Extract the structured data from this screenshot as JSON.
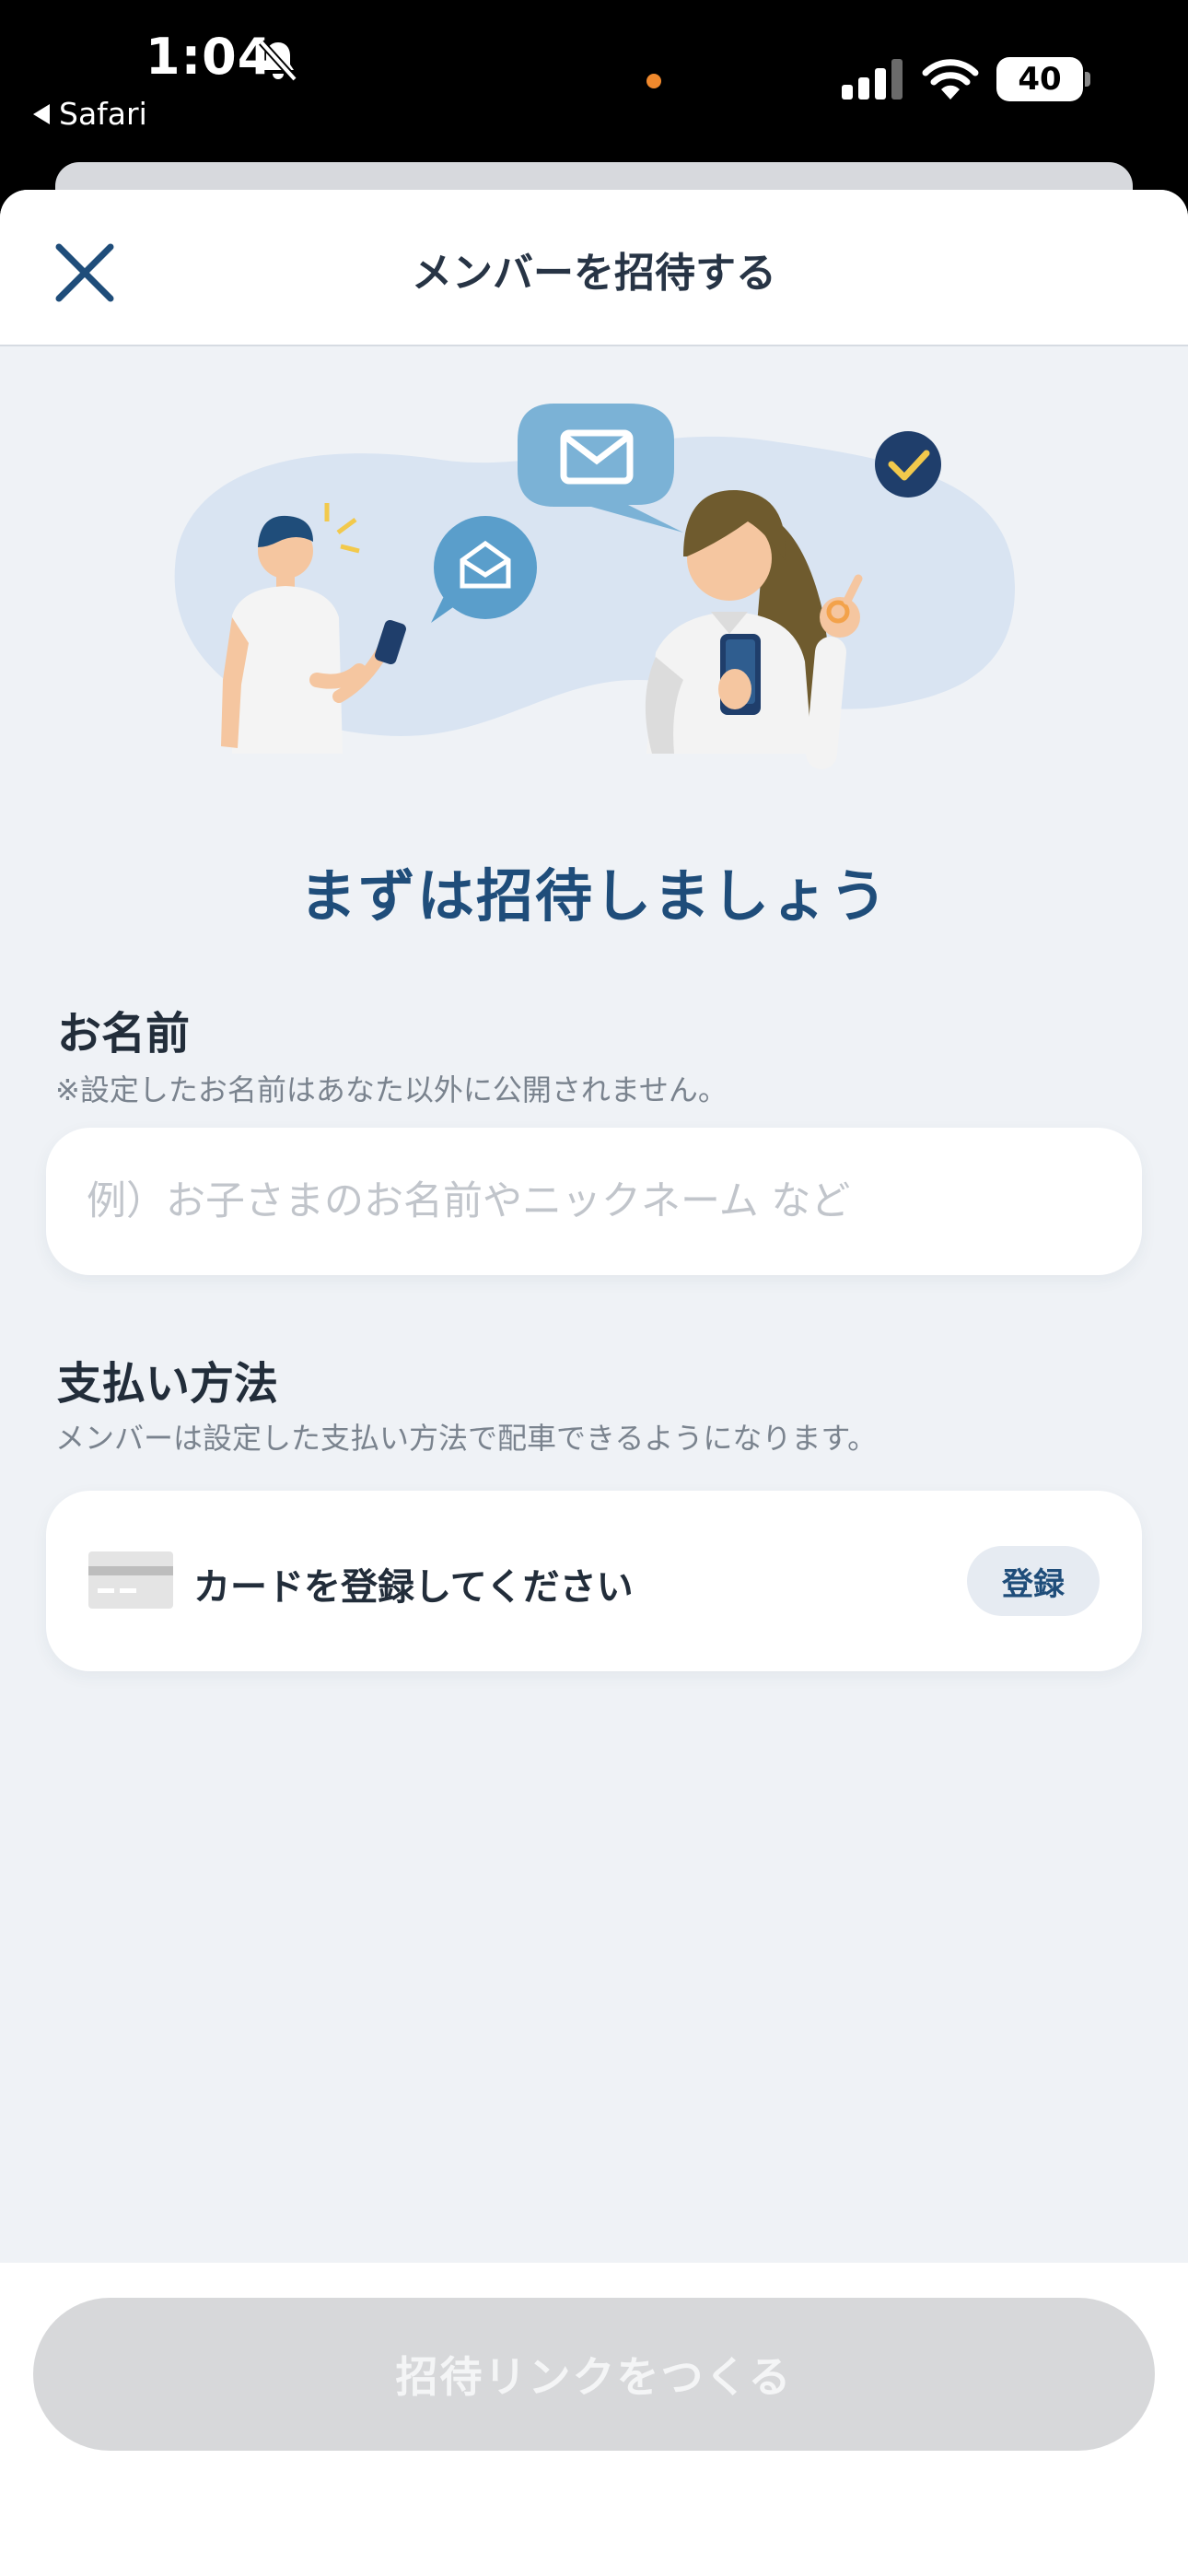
{
  "status_bar": {
    "time": "1:04",
    "back_app": "Safari",
    "battery": "40"
  },
  "header": {
    "title": "メンバーを招待する"
  },
  "headline": "まずは招待しましょう",
  "name_section": {
    "label": "お名前",
    "note": "※設定したお名前はあなた以外に公開されません。",
    "placeholder": "例）お子さまのお名前やニックネーム など",
    "value": ""
  },
  "payment_section": {
    "label": "支払い方法",
    "note": "メンバーは設定した支払い方法で配車できるようになります。",
    "card_text": "カードを登録してください",
    "register_label": "登録"
  },
  "footer": {
    "create_label": "招待リンクをつくる"
  },
  "colors": {
    "accent": "#1f4d7a",
    "background": "#eff2f6",
    "disabled_button": "#d7d8da",
    "recording_dot": "#f0892d"
  }
}
